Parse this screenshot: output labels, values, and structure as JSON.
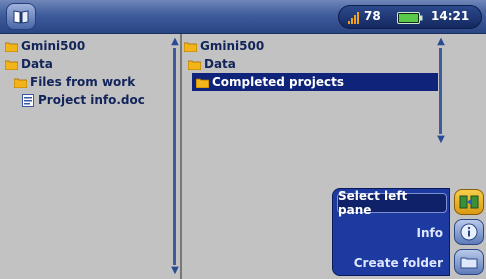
{
  "status": {
    "volume": "78",
    "time": "14:21"
  },
  "left_pane": {
    "items": [
      {
        "label": "Gmini500",
        "icon": "folder-icon"
      },
      {
        "label": "Data",
        "icon": "folder-icon"
      },
      {
        "label": "Files from work",
        "icon": "folder-icon"
      },
      {
        "label": "Project info.doc",
        "icon": "document-icon"
      }
    ]
  },
  "right_pane": {
    "items": [
      {
        "label": "Gmini500",
        "icon": "folder-icon"
      },
      {
        "label": "Data",
        "icon": "folder-icon"
      },
      {
        "label": "Completed projects",
        "icon": "folder-icon",
        "selected": true
      }
    ]
  },
  "menu": {
    "items": [
      {
        "label": "Select left pane",
        "highlighted": true
      },
      {
        "label": "Info"
      },
      {
        "label": "Create folder"
      }
    ]
  },
  "colors": {
    "accent": "#1d3aa0",
    "selection": "#10237a",
    "pane_bg": "#c2c2c2",
    "folder": "#f2b418",
    "active_button": "#e8b22c"
  }
}
